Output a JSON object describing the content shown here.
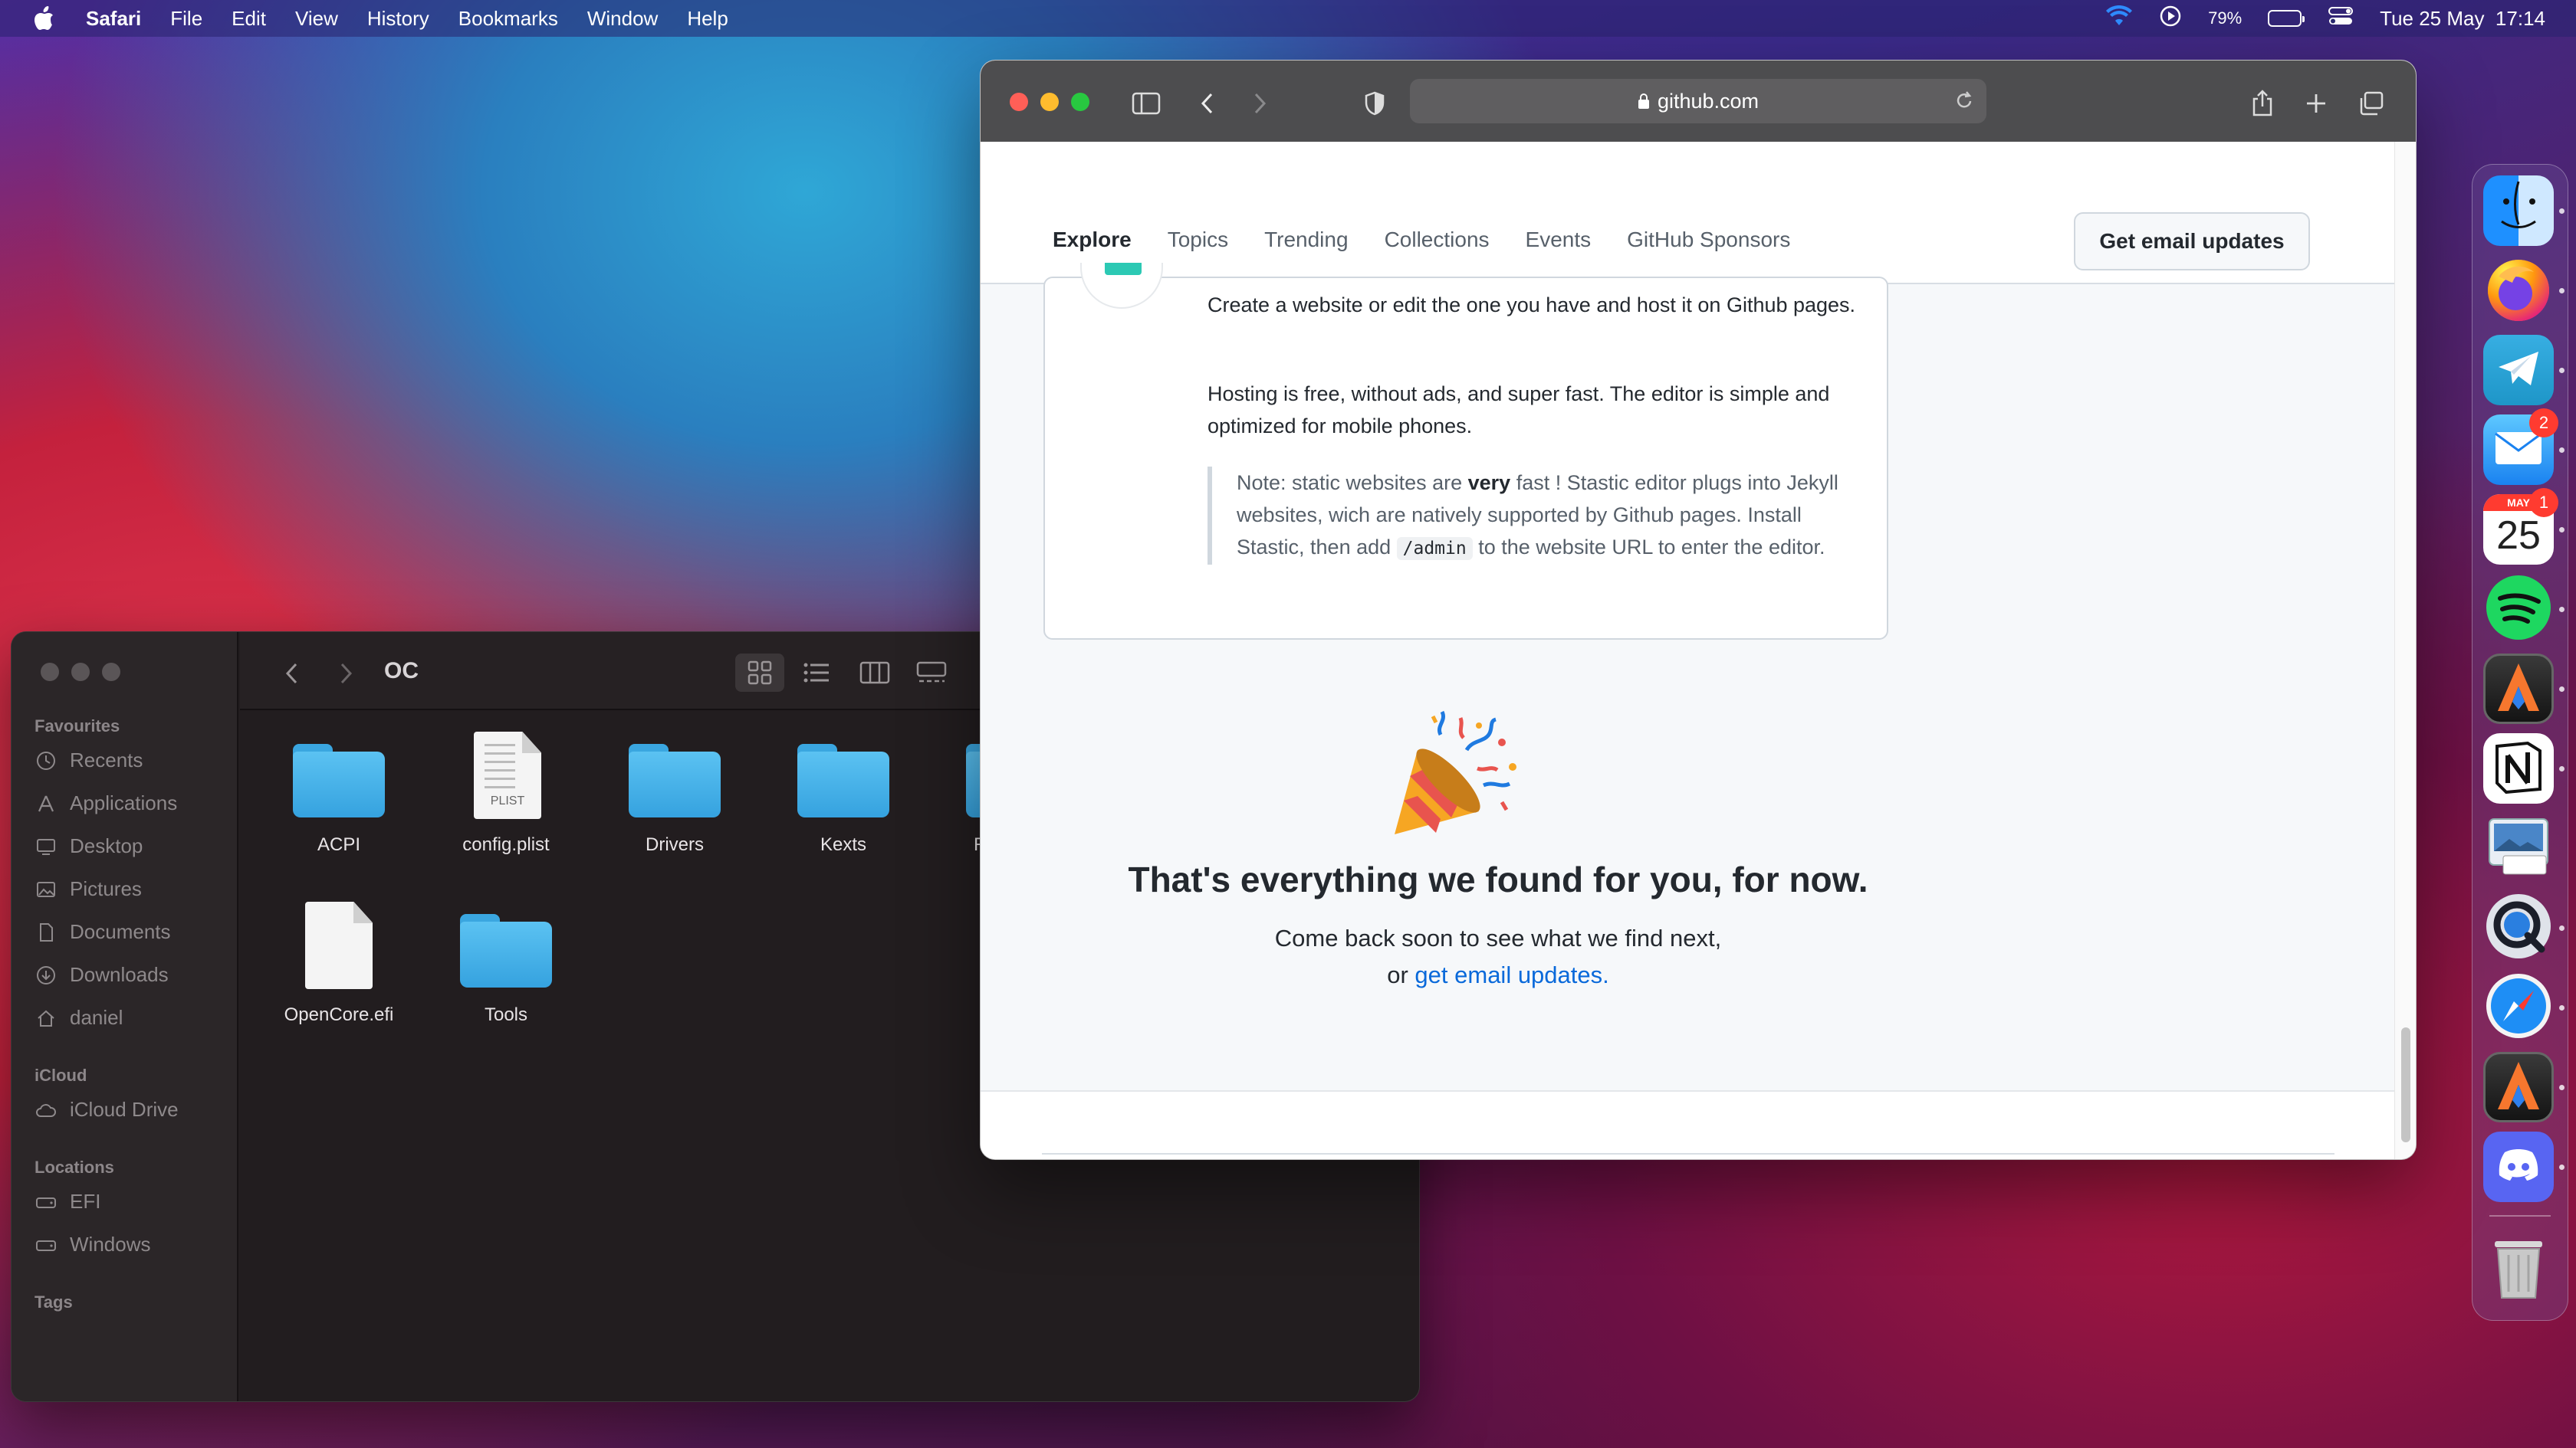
{
  "menubar": {
    "app_name": "Safari",
    "menus": [
      "File",
      "Edit",
      "View",
      "History",
      "Bookmarks",
      "Window",
      "Help"
    ],
    "battery_percent": "79%",
    "battery_level": 0.79,
    "datetime": "Tue 25 May  17:14"
  },
  "finder": {
    "title": "OC",
    "sidebar": {
      "favourites_label": "Favourites",
      "favourites": [
        "Recents",
        "Applications",
        "Desktop",
        "Pictures",
        "Documents",
        "Downloads",
        "daniel"
      ],
      "icloud_label": "iCloud",
      "icloud": [
        "iCloud Drive"
      ],
      "locations_label": "Locations",
      "locations": [
        "EFI",
        "Windows"
      ],
      "tags_label": "Tags"
    },
    "files": [
      {
        "name": "ACPI",
        "kind": "folder"
      },
      {
        "name": "config.plist",
        "kind": "plist",
        "tag": "PLIST"
      },
      {
        "name": "Drivers",
        "kind": "folder"
      },
      {
        "name": "Kexts",
        "kind": "folder"
      },
      {
        "name": "Re",
        "kind": "folder"
      },
      {
        "name": "OpenCore.efi",
        "kind": "document"
      },
      {
        "name": "Tools",
        "kind": "folder"
      }
    ]
  },
  "safari": {
    "url": "github.com",
    "tabs": [
      "Explore",
      "Topics",
      "Trending",
      "Collections",
      "Events",
      "GitHub Sponsors"
    ],
    "active_tab": "Explore",
    "email_button": "Get email updates",
    "card": {
      "p1": "Create a website or edit the one you have and host it on Github pages.",
      "p2": "Hosting is free, without ads, and super fast. The editor is simple and optimized for mobile phones.",
      "note_before": "Note: static websites are ",
      "note_bold": "very",
      "note_mid": " fast ! Stastic editor plugs into Jekyll websites, wich are natively supported by Github pages. Install Stastic, then add ",
      "note_code": "/admin",
      "note_after": " to the website URL to enter the editor."
    },
    "end_title": "That's everything we found for you, for now.",
    "end_line1": "Come back soon to see what we find next,",
    "end_line2_prefix": "or ",
    "end_link": "get email updates."
  },
  "dock": {
    "apps": [
      "Finder",
      "Firefox",
      "Telegram",
      "Mail",
      "Calendar",
      "Spotify",
      "Alacritty",
      "Notion",
      "Preview",
      "QuickTime Player",
      "Safari",
      "Alacritty",
      "Discord",
      "Trash"
    ],
    "mail_badge": "2",
    "calendar_badge": "1",
    "calendar_month": "MAY",
    "calendar_day": "25"
  },
  "colors": {
    "accent_link": "#0969da",
    "tab_underline": "#fd8c73",
    "folder_blue": "#35a2df"
  }
}
